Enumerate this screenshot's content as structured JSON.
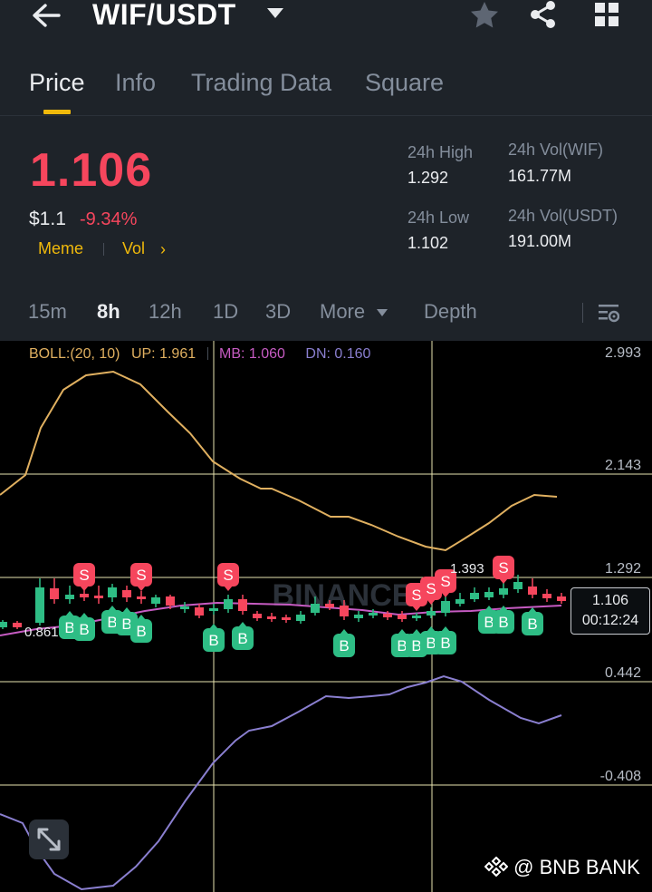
{
  "header": {
    "pair": "WIF/USDT",
    "tabs": [
      {
        "label": "Price",
        "active": true
      },
      {
        "label": "Info",
        "active": false
      },
      {
        "label": "Trading Data",
        "active": false
      },
      {
        "label": "Square",
        "active": false
      }
    ],
    "icons": [
      "back-arrow-icon",
      "caret-down-icon",
      "star-icon",
      "share-icon",
      "grid-icon"
    ]
  },
  "ticker": {
    "last_price": "1.106",
    "fiat_price": "$1.1",
    "change_pct": "-9.34%",
    "tags": [
      "Meme",
      "Vol"
    ],
    "tag_chevron": "›",
    "high_label": "24h High",
    "high_value": "1.292",
    "low_label": "24h Low",
    "low_value": "1.102",
    "vol_base_label": "24h Vol(WIF)",
    "vol_base_value": "161.77M",
    "vol_quote_label": "24h Vol(USDT)",
    "vol_quote_value": "191.00M"
  },
  "timeframes": {
    "items": [
      "15m",
      "8h",
      "12h",
      "1D",
      "3D",
      "More"
    ],
    "active": "8h",
    "depth_label": "Depth"
  },
  "chart": {
    "boll_label": "BOLL:(20, 10)",
    "up_label": "UP: 1.961",
    "mb_label": "MB: 1.060",
    "dn_label": "DN: 0.160",
    "price_axis": [
      "2.993",
      "2.143",
      "1.292",
      "0.442",
      "-0.408"
    ],
    "high_marker": "1.393",
    "low_marker": "0.861",
    "current_price": "1.106",
    "countdown": "00:12:24",
    "watermark_text": "BINANCE",
    "sell_marker": "S",
    "buy_marker": "B"
  },
  "colors": {
    "up": "#2ebd85",
    "down": "#f6465d",
    "accent": "#f0b90b",
    "boll_up": "#e0b060",
    "boll_mb": "#c65bc2",
    "boll_dn": "#8a7fd0"
  },
  "footer": {
    "credit": "@ BNB BANK"
  }
}
